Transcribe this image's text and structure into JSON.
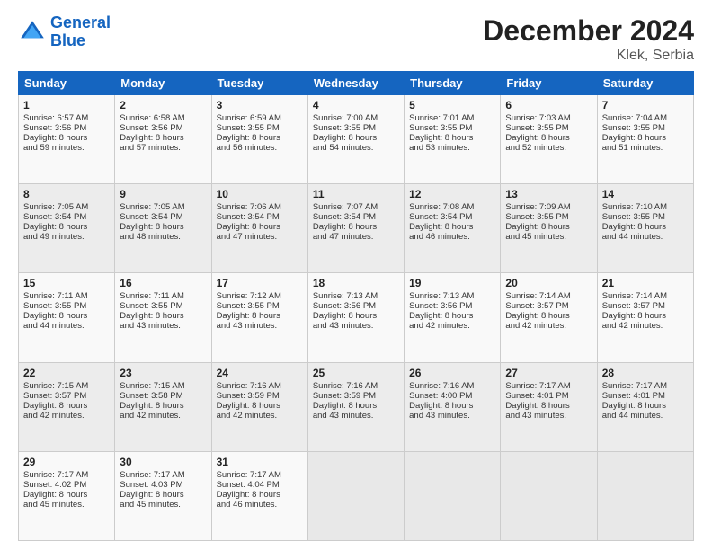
{
  "header": {
    "logo_line1": "General",
    "logo_line2": "Blue",
    "title": "December 2024",
    "subtitle": "Klek, Serbia"
  },
  "weekdays": [
    "Sunday",
    "Monday",
    "Tuesday",
    "Wednesday",
    "Thursday",
    "Friday",
    "Saturday"
  ],
  "weeks": [
    [
      {
        "day": "1",
        "lines": [
          "Sunrise: 6:57 AM",
          "Sunset: 3:56 PM",
          "Daylight: 8 hours",
          "and 59 minutes."
        ]
      },
      {
        "day": "2",
        "lines": [
          "Sunrise: 6:58 AM",
          "Sunset: 3:56 PM",
          "Daylight: 8 hours",
          "and 57 minutes."
        ]
      },
      {
        "day": "3",
        "lines": [
          "Sunrise: 6:59 AM",
          "Sunset: 3:55 PM",
          "Daylight: 8 hours",
          "and 56 minutes."
        ]
      },
      {
        "day": "4",
        "lines": [
          "Sunrise: 7:00 AM",
          "Sunset: 3:55 PM",
          "Daylight: 8 hours",
          "and 54 minutes."
        ]
      },
      {
        "day": "5",
        "lines": [
          "Sunrise: 7:01 AM",
          "Sunset: 3:55 PM",
          "Daylight: 8 hours",
          "and 53 minutes."
        ]
      },
      {
        "day": "6",
        "lines": [
          "Sunrise: 7:03 AM",
          "Sunset: 3:55 PM",
          "Daylight: 8 hours",
          "and 52 minutes."
        ]
      },
      {
        "day": "7",
        "lines": [
          "Sunrise: 7:04 AM",
          "Sunset: 3:55 PM",
          "Daylight: 8 hours",
          "and 51 minutes."
        ]
      }
    ],
    [
      {
        "day": "8",
        "lines": [
          "Sunrise: 7:05 AM",
          "Sunset: 3:54 PM",
          "Daylight: 8 hours",
          "and 49 minutes."
        ]
      },
      {
        "day": "9",
        "lines": [
          "Sunrise: 7:05 AM",
          "Sunset: 3:54 PM",
          "Daylight: 8 hours",
          "and 48 minutes."
        ]
      },
      {
        "day": "10",
        "lines": [
          "Sunrise: 7:06 AM",
          "Sunset: 3:54 PM",
          "Daylight: 8 hours",
          "and 47 minutes."
        ]
      },
      {
        "day": "11",
        "lines": [
          "Sunrise: 7:07 AM",
          "Sunset: 3:54 PM",
          "Daylight: 8 hours",
          "and 47 minutes."
        ]
      },
      {
        "day": "12",
        "lines": [
          "Sunrise: 7:08 AM",
          "Sunset: 3:54 PM",
          "Daylight: 8 hours",
          "and 46 minutes."
        ]
      },
      {
        "day": "13",
        "lines": [
          "Sunrise: 7:09 AM",
          "Sunset: 3:55 PM",
          "Daylight: 8 hours",
          "and 45 minutes."
        ]
      },
      {
        "day": "14",
        "lines": [
          "Sunrise: 7:10 AM",
          "Sunset: 3:55 PM",
          "Daylight: 8 hours",
          "and 44 minutes."
        ]
      }
    ],
    [
      {
        "day": "15",
        "lines": [
          "Sunrise: 7:11 AM",
          "Sunset: 3:55 PM",
          "Daylight: 8 hours",
          "and 44 minutes."
        ]
      },
      {
        "day": "16",
        "lines": [
          "Sunrise: 7:11 AM",
          "Sunset: 3:55 PM",
          "Daylight: 8 hours",
          "and 43 minutes."
        ]
      },
      {
        "day": "17",
        "lines": [
          "Sunrise: 7:12 AM",
          "Sunset: 3:55 PM",
          "Daylight: 8 hours",
          "and 43 minutes."
        ]
      },
      {
        "day": "18",
        "lines": [
          "Sunrise: 7:13 AM",
          "Sunset: 3:56 PM",
          "Daylight: 8 hours",
          "and 43 minutes."
        ]
      },
      {
        "day": "19",
        "lines": [
          "Sunrise: 7:13 AM",
          "Sunset: 3:56 PM",
          "Daylight: 8 hours",
          "and 42 minutes."
        ]
      },
      {
        "day": "20",
        "lines": [
          "Sunrise: 7:14 AM",
          "Sunset: 3:57 PM",
          "Daylight: 8 hours",
          "and 42 minutes."
        ]
      },
      {
        "day": "21",
        "lines": [
          "Sunrise: 7:14 AM",
          "Sunset: 3:57 PM",
          "Daylight: 8 hours",
          "and 42 minutes."
        ]
      }
    ],
    [
      {
        "day": "22",
        "lines": [
          "Sunrise: 7:15 AM",
          "Sunset: 3:57 PM",
          "Daylight: 8 hours",
          "and 42 minutes."
        ]
      },
      {
        "day": "23",
        "lines": [
          "Sunrise: 7:15 AM",
          "Sunset: 3:58 PM",
          "Daylight: 8 hours",
          "and 42 minutes."
        ]
      },
      {
        "day": "24",
        "lines": [
          "Sunrise: 7:16 AM",
          "Sunset: 3:59 PM",
          "Daylight: 8 hours",
          "and 42 minutes."
        ]
      },
      {
        "day": "25",
        "lines": [
          "Sunrise: 7:16 AM",
          "Sunset: 3:59 PM",
          "Daylight: 8 hours",
          "and 43 minutes."
        ]
      },
      {
        "day": "26",
        "lines": [
          "Sunrise: 7:16 AM",
          "Sunset: 4:00 PM",
          "Daylight: 8 hours",
          "and 43 minutes."
        ]
      },
      {
        "day": "27",
        "lines": [
          "Sunrise: 7:17 AM",
          "Sunset: 4:01 PM",
          "Daylight: 8 hours",
          "and 43 minutes."
        ]
      },
      {
        "day": "28",
        "lines": [
          "Sunrise: 7:17 AM",
          "Sunset: 4:01 PM",
          "Daylight: 8 hours",
          "and 44 minutes."
        ]
      }
    ],
    [
      {
        "day": "29",
        "lines": [
          "Sunrise: 7:17 AM",
          "Sunset: 4:02 PM",
          "Daylight: 8 hours",
          "and 45 minutes."
        ]
      },
      {
        "day": "30",
        "lines": [
          "Sunrise: 7:17 AM",
          "Sunset: 4:03 PM",
          "Daylight: 8 hours",
          "and 45 minutes."
        ]
      },
      {
        "day": "31",
        "lines": [
          "Sunrise: 7:17 AM",
          "Sunset: 4:04 PM",
          "Daylight: 8 hours",
          "and 46 minutes."
        ]
      },
      null,
      null,
      null,
      null
    ]
  ]
}
